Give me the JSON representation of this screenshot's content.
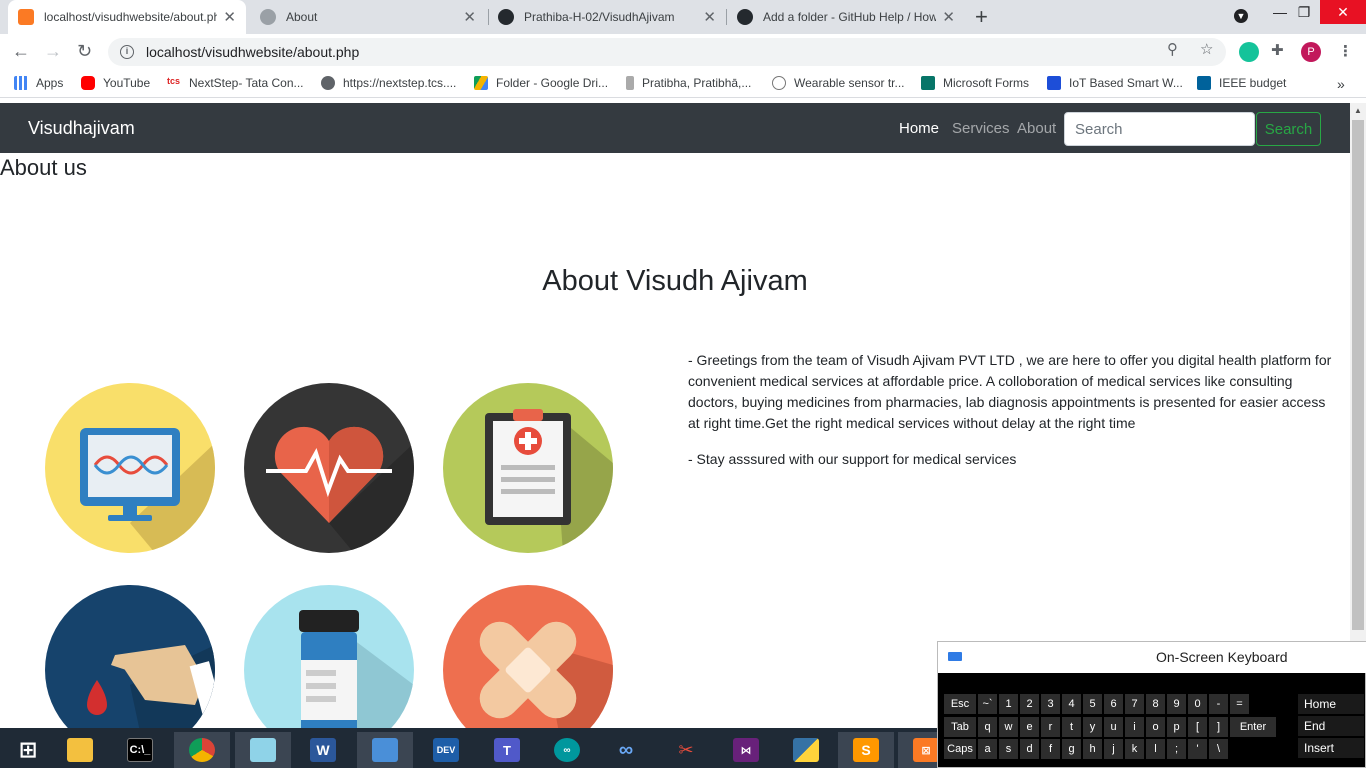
{
  "browser": {
    "tabs": [
      {
        "title": "localhost/visudhwebsite/about.ph",
        "active": true,
        "favicon": "xampp-icon"
      },
      {
        "title": "About",
        "active": false,
        "favicon": "globe-icon"
      },
      {
        "title": "Prathiba-H-02/VisudhAjivam",
        "active": false,
        "favicon": "github-icon"
      },
      {
        "title": "Add a folder - GitHub Help / How",
        "active": false,
        "favicon": "github-icon"
      }
    ],
    "url": "localhost/visudhwebsite/about.php",
    "profile_initial": "P",
    "bookmarks": [
      {
        "label": "Apps",
        "icon": "apps-grid-icon"
      },
      {
        "label": "YouTube",
        "icon": "youtube-icon"
      },
      {
        "label": "NextStep- Tata Con...",
        "icon": "tcs-icon"
      },
      {
        "label": "https://nextstep.tcs....",
        "icon": "globe-icon"
      },
      {
        "label": "Folder - Google Dri...",
        "icon": "google-drive-icon"
      },
      {
        "label": "Pratibha, Pratibhā,...",
        "icon": "pen-icon"
      },
      {
        "label": "Wearable sensor tr...",
        "icon": "scholar-icon"
      },
      {
        "label": "Microsoft Forms",
        "icon": "forms-icon"
      },
      {
        "label": "IoT Based Smart W...",
        "icon": "researchgate-icon"
      },
      {
        "label": "IEEE budget",
        "icon": "ieee-icon"
      }
    ]
  },
  "site": {
    "brand": "Visudhajivam",
    "nav": [
      "Home",
      "Services",
      "About"
    ],
    "search_placeholder": "Search",
    "search_button": "Search",
    "about_us": "About us",
    "hero_title": "About Visudh Ajivam",
    "paragraph1": "- Greetings from the team of Visudh Ajivam PVT LTD , we are here to offer you digital health platform for convenient medical services at affordable price. A colloboration of medical services like consulting doctors, buying medicines from pharmacies, lab diagnosis appointments is presented for easier access at right time.Get the right medical services without delay at the right time",
    "paragraph2": "- Stay asssured with our support for medical services",
    "icons": [
      "dna-monitor-icon",
      "heartbeat-icon",
      "medical-clipboard-icon",
      "blood-test-icon",
      "medicine-bottle-icon",
      "bandage-icon"
    ]
  },
  "osk": {
    "title": "On-Screen Keyboard",
    "row1": [
      "Esc",
      "~`",
      "1",
      "2",
      "3",
      "4",
      "5",
      "6",
      "7",
      "8",
      "9",
      "0",
      "-",
      "="
    ],
    "row2": [
      "Tab",
      "q",
      "w",
      "e",
      "r",
      "t",
      "y",
      "u",
      "i",
      "o",
      "p",
      "[",
      "]",
      "Enter"
    ],
    "row3": [
      "Caps",
      "a",
      "s",
      "d",
      "f",
      "g",
      "h",
      "j",
      "k",
      "l",
      ";",
      "'",
      "\\"
    ],
    "side": [
      "Home",
      "End",
      "Insert"
    ]
  },
  "colors": {
    "navbar": "#343a40",
    "search_green": "#28a745",
    "taskbar": "#1f2a36"
  }
}
